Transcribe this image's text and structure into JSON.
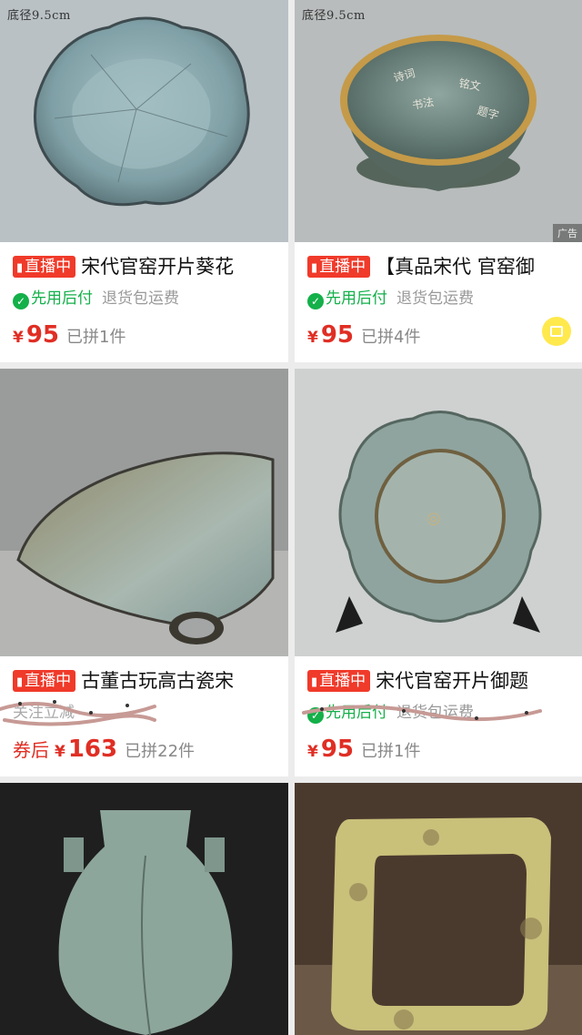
{
  "products": [
    {
      "image_caption": "底径9.5cm",
      "live_badge": "直播中",
      "title": "宋代官窑开片葵花",
      "pay_later": "先用后付",
      "returns": "退货包运费",
      "currency": "¥",
      "price": "95",
      "sold": "已拼1件"
    },
    {
      "image_caption": "底径9.5cm",
      "ad_label": "广告",
      "live_badge": "直播中",
      "title": "【真品宋代 官窑御",
      "pay_later": "先用后付",
      "returns": "退货包运费",
      "currency": "¥",
      "price": "95",
      "sold": "已拼4件",
      "chat_icon": "camera-icon"
    },
    {
      "live_badge": "直播中",
      "title": "古董古玩高古瓷宋",
      "obscured_text": "关注立减",
      "coupon_label": "券后",
      "currency": "¥",
      "price": "163",
      "sold": "已拼22件"
    },
    {
      "live_badge": "直播中",
      "title": "宋代官窑开片御题",
      "pay_later": "先用后付",
      "returns": "退货包运费",
      "currency": "¥",
      "price": "95",
      "sold": "已拼1件"
    },
    {},
    {}
  ],
  "colors": {
    "accent_red": "#e02e24",
    "live_badge_bg": "#f03a2a",
    "pay_later_green": "#14b04a",
    "page_bg": "#ececec"
  }
}
